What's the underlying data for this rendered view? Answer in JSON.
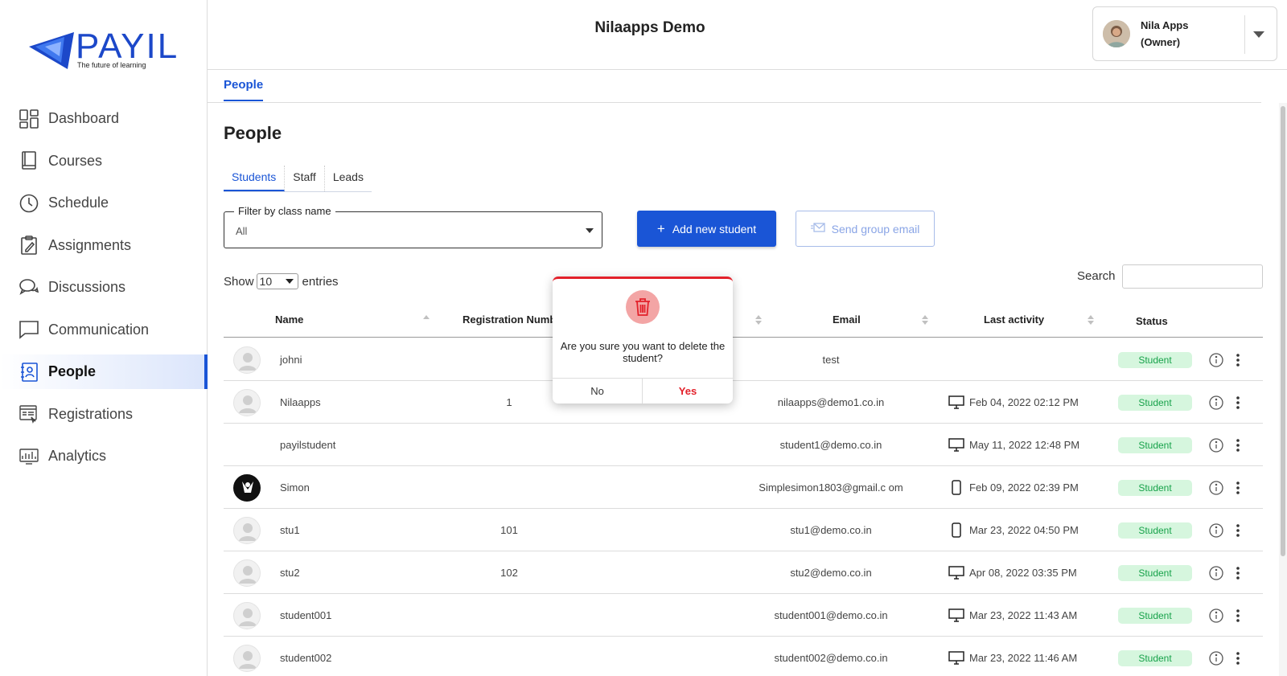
{
  "brand": {
    "name": "PAYIL",
    "tagline": "The future of learning"
  },
  "sidebar": {
    "items": [
      {
        "label": "Dashboard",
        "icon": "dashboard-icon"
      },
      {
        "label": "Courses",
        "icon": "book-icon"
      },
      {
        "label": "Schedule",
        "icon": "clock-icon"
      },
      {
        "label": "Assignments",
        "icon": "clipboard-icon"
      },
      {
        "label": "Discussions",
        "icon": "chat-bubbles-icon"
      },
      {
        "label": "Communication",
        "icon": "message-icon"
      },
      {
        "label": "People",
        "icon": "contacts-icon",
        "active": true
      },
      {
        "label": "Registrations",
        "icon": "registration-form-icon"
      },
      {
        "label": "Analytics",
        "icon": "analytics-icon"
      }
    ]
  },
  "header": {
    "title": "Nilaapps Demo",
    "user": {
      "name": "Nila Apps",
      "role": "(Owner)"
    }
  },
  "top_tab": "People",
  "page_title": "People",
  "subtabs": [
    "Students",
    "Staff",
    "Leads"
  ],
  "filter": {
    "label": "Filter by class name",
    "value": "All"
  },
  "buttons": {
    "add_student": "Add new student",
    "group_email": "Send group email"
  },
  "entries": {
    "show": "Show",
    "value": "10",
    "suffix": "entries"
  },
  "search": {
    "label": "Search",
    "value": ""
  },
  "table": {
    "columns": [
      "Name",
      "Registration Number",
      "Email",
      "Last activity",
      "Status"
    ],
    "visible_columns": {
      "name": "Name",
      "reg": "Registration Numb",
      "email": "Email",
      "activity": "Last activity",
      "status": "Status"
    },
    "rows": [
      {
        "name": "johni",
        "reg": "",
        "email": "test",
        "device": "",
        "activity": "",
        "status": "Student",
        "avatar": "placeholder"
      },
      {
        "name": "Nilaapps",
        "reg": "1",
        "email": "nilaapps@demo1.co.in",
        "device": "desktop",
        "activity": "Feb 04, 2022 02:12 PM",
        "status": "Student",
        "avatar": "placeholder"
      },
      {
        "name": "payilstudent",
        "reg": "",
        "email": "student1@demo.co.in",
        "device": "desktop",
        "activity": "May 11, 2022 12:48 PM",
        "status": "Student",
        "avatar": "none"
      },
      {
        "name": "Simon",
        "reg": "",
        "email": "Simplesimon1803@gmail.c om",
        "device": "mobile",
        "activity": "Feb 09, 2022 02:39 PM",
        "status": "Student",
        "avatar": "dark"
      },
      {
        "name": "stu1",
        "reg": "101",
        "email": "stu1@demo.co.in",
        "device": "mobile",
        "activity": "Mar 23, 2022 04:50 PM",
        "status": "Student",
        "avatar": "placeholder"
      },
      {
        "name": "stu2",
        "reg": "102",
        "email": "stu2@demo.co.in",
        "device": "desktop",
        "activity": "Apr 08, 2022 03:35 PM",
        "status": "Student",
        "avatar": "placeholder"
      },
      {
        "name": "student001",
        "reg": "",
        "email": "student001@demo.co.in",
        "device": "desktop",
        "activity": "Mar 23, 2022 11:43 AM",
        "status": "Student",
        "avatar": "placeholder"
      },
      {
        "name": "student002",
        "reg": "",
        "email": "student002@demo.co.in",
        "device": "desktop",
        "activity": "Mar 23, 2022 11:46 AM",
        "status": "Student",
        "avatar": "placeholder"
      }
    ]
  },
  "modal": {
    "message": "Are you sure you want to delete the student?",
    "no": "No",
    "yes": "Yes"
  },
  "colors": {
    "primary": "#1a55d6",
    "danger": "#e3212b",
    "badge_bg": "#d6f6de",
    "badge_text": "#17a24a"
  }
}
